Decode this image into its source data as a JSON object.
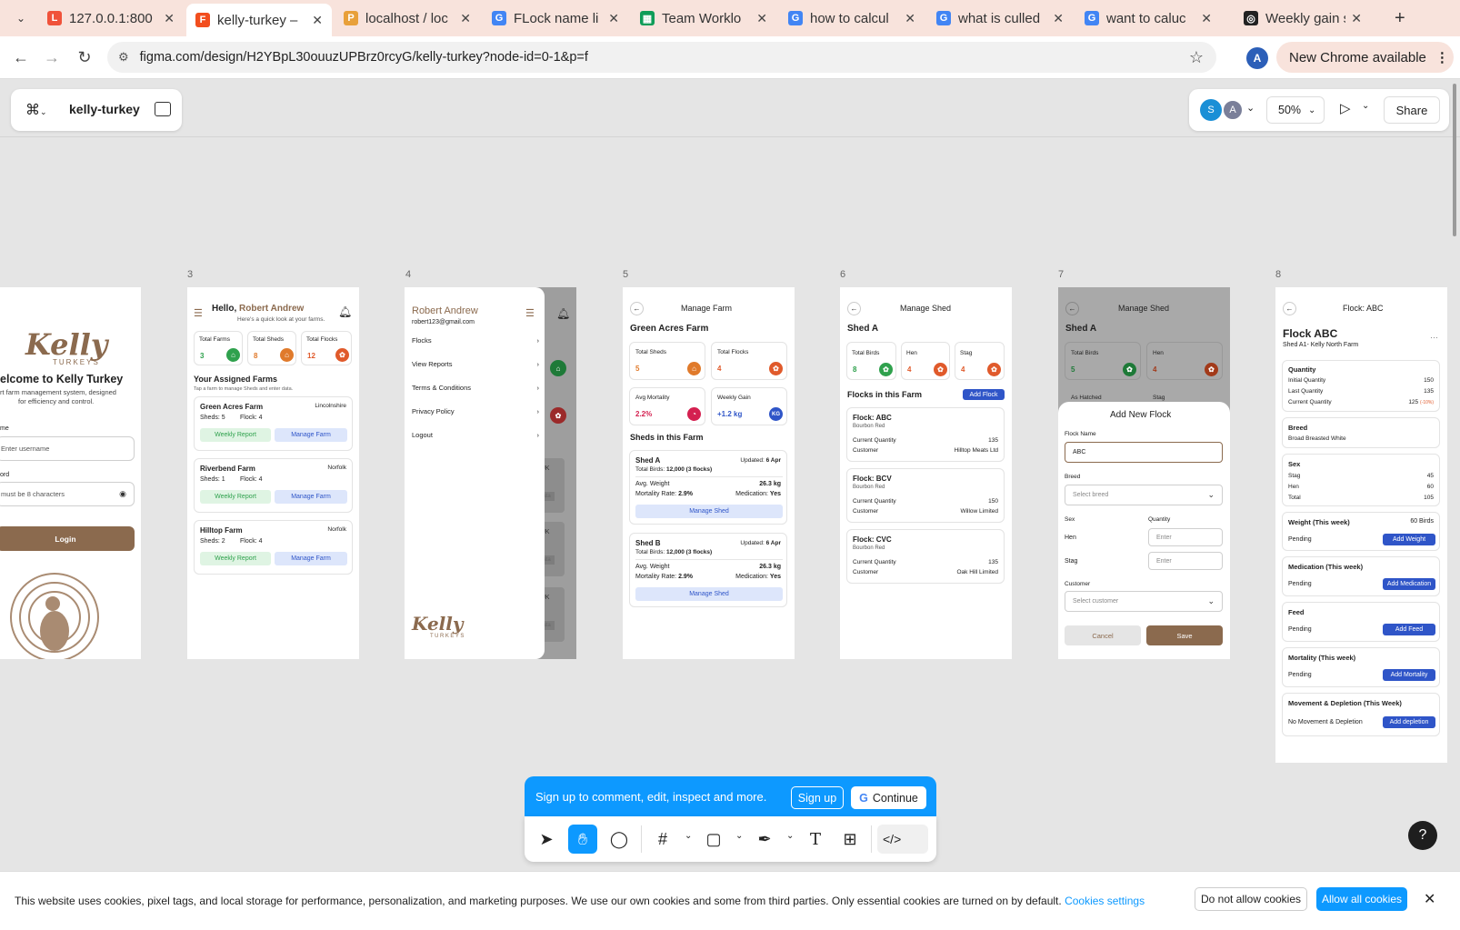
{
  "browser": {
    "tabs": [
      {
        "title": "127.0.0.1:800",
        "icon": "laravel-icon",
        "color": "#f0523a"
      },
      {
        "title": "kelly-turkey –",
        "icon": "figma-icon",
        "color": "#f24e1e",
        "active": true
      },
      {
        "title": "localhost / loc",
        "icon": "phpmyadmin-icon",
        "color": "#e8a03a"
      },
      {
        "title": "FLock name li",
        "icon": "google-icon",
        "color": "#4285f4"
      },
      {
        "title": "Team Worklo",
        "icon": "sheets-icon",
        "color": "#0f9d58"
      },
      {
        "title": "how to calcul",
        "icon": "google-icon",
        "color": "#4285f4"
      },
      {
        "title": "what is culled",
        "icon": "google-icon",
        "color": "#4285f4"
      },
      {
        "title": "want to caluc",
        "icon": "google-icon",
        "color": "#4285f4"
      },
      {
        "title": "Weekly gain s",
        "icon": "openai-icon",
        "color": "#222"
      }
    ],
    "url": "figma.com/design/H2YBpL30ouuzUPBrz0rcyG/kelly-turkey?node-id=0-1&p=f",
    "profile_initial": "A",
    "update_label": "New Chrome available"
  },
  "figma": {
    "file_name": "kelly-turkey",
    "avatars": [
      "S",
      "A"
    ],
    "zoom": "50%",
    "share_label": "Share"
  },
  "frames": {
    "labels": [
      "3",
      "4",
      "5",
      "6",
      "7",
      "8"
    ],
    "login": {
      "logo": "Kelly",
      "logo_sub": "TURKEYS",
      "welcome": "elcome to Kelly Turkey",
      "desc1": "rt farm management system, designed",
      "desc2": "for efficiency and control.",
      "user_label": "me",
      "user_ph": "Enter username",
      "pass_label": "ord",
      "pass_ph": "must be 8 characters",
      "login_btn": "Login"
    },
    "dashboard": {
      "hello": "Hello,",
      "name": "Robert Andrew",
      "sub": "Here's a quick look at your farms.",
      "stats": [
        {
          "label": "Total Farms",
          "value": "3"
        },
        {
          "label": "Total Sheds",
          "value": "8"
        },
        {
          "label": "Total Flocks",
          "value": "12"
        }
      ],
      "section": "Your Assigned Farms",
      "section_sub": "Tap a farm to manage Sheds and enter data.",
      "farms": [
        {
          "name": "Green Acres Farm",
          "loc": "Lincolnshire",
          "sheds": "Sheds: 5",
          "flock": "Flock: 4"
        },
        {
          "name": "Riverbend Farm",
          "loc": "Norfolk",
          "sheds": "Sheds: 1",
          "flock": "Flock: 4"
        },
        {
          "name": "Hilltop Farm",
          "loc": "Norfolk",
          "sheds": "Sheds: 2",
          "flock": "Flock: 4"
        }
      ],
      "weekly": "Weekly Report",
      "manage": "Manage Farm"
    },
    "menu": {
      "name": "Robert Andrew",
      "email": "robert123@gmail.com",
      "items": [
        "Flocks",
        "View Reports",
        "Terms & Conditions",
        "Privacy Policy",
        "Logout"
      ],
      "logo": "Kelly",
      "logo_sub": "TURKEYS",
      "bg": [
        "rk, UK",
        "Data",
        "rk, UK",
        "Data",
        "rk, UK",
        "Data"
      ]
    },
    "manage_farm": {
      "title": "Manage Farm",
      "farm": "Green Acres Farm",
      "stats": [
        {
          "label": "Total Sheds",
          "value": "5"
        },
        {
          "label": "Total Flocks",
          "value": "4"
        },
        {
          "label": "Avg Mortality",
          "value": "2.2%"
        },
        {
          "label": "Weekly Gain",
          "value": "+1.2 kg",
          "badge": "KG"
        }
      ],
      "section": "Sheds in this Farm",
      "sheds": [
        {
          "name": "Shed A",
          "updated": "Updated:",
          "date": "6 Apr",
          "birds_l": "Total Birds:",
          "birds": "12,000 (3 flocks)",
          "weight_l": "Avg. Weight",
          "weight": "26.3 kg",
          "mort_l": "Mortality Rate:",
          "mort": "2.9%",
          "med_l": "Medication:",
          "med": "Yes",
          "btn": "Manage Shed"
        },
        {
          "name": "Shed B",
          "updated": "Updated:",
          "date": "6 Apr",
          "birds_l": "Total Birds:",
          "birds": "12,000 (3 flocks)",
          "weight_l": "Avg. Weight",
          "weight": "26.3 kg",
          "mort_l": "Mortality Rate:",
          "mort": "2.9%",
          "med_l": "Medication:",
          "med": "Yes",
          "btn": "Manage Shed"
        }
      ]
    },
    "manage_shed": {
      "title": "Manage Shed",
      "shed": "Shed A",
      "stats": [
        {
          "label": "Total Birds",
          "value": "8"
        },
        {
          "label": "Hen",
          "value": "4"
        },
        {
          "label": "Stag",
          "value": "4"
        }
      ],
      "section": "Flocks in this Farm",
      "add": "Add Flock",
      "flocks": [
        {
          "name": "Flock: ABC",
          "breed": "Bourbon Red",
          "qty_l": "Current Quantity",
          "qty": "135",
          "cust_l": "Customer",
          "cust": "Hilltop Meats Ltd"
        },
        {
          "name": "Flock: BCV",
          "breed": "Bourbon Red",
          "qty_l": "Current Quantity",
          "qty": "150",
          "cust_l": "Customer",
          "cust": "Willow Limited"
        },
        {
          "name": "Flock: CVC",
          "breed": "Bourbon Red",
          "qty_l": "Current Quantity",
          "qty": "135",
          "cust_l": "Customer",
          "cust": "Oak Hill Limited"
        }
      ]
    },
    "add_flock": {
      "title": "Manage Shed",
      "shed": "Shed A",
      "bg_stats": [
        {
          "label": "Total Birds",
          "value": "5"
        },
        {
          "label": "Hen",
          "value": "4"
        }
      ],
      "bg2": [
        "As Hatched",
        "Stag"
      ],
      "modal": "Add New Flock",
      "name_l": "Flock Name",
      "name_v": "ABC",
      "breed_l": "Breed",
      "breed_ph": "Select breed",
      "sex_l": "Sex",
      "qty_l": "Quantity",
      "hen": "Hen",
      "stag": "Stag",
      "enter": "Enter",
      "cust_l": "Customer",
      "cust_ph": "Select customer",
      "cancel": "Cancel",
      "save": "Save"
    },
    "flock": {
      "title": "Flock: ABC",
      "heading": "Flock ABC",
      "sub": "Shed A1- Kelly North Farm",
      "dots": "···",
      "quantity": {
        "title": "Quantity",
        "rows": [
          {
            "l": "Initial Quantity",
            "v": "150"
          },
          {
            "l": "Last Quantity",
            "v": "135"
          },
          {
            "l": "Current Quantity",
            "v": "125",
            "note": "(-10%)"
          }
        ]
      },
      "breed": {
        "title": "Breed",
        "v": "Broad Breasted White"
      },
      "sex": {
        "title": "Sex",
        "rows": [
          {
            "l": "Stag",
            "v": "45"
          },
          {
            "l": "Hen",
            "v": "60"
          },
          {
            "l": "Total",
            "v": "105"
          }
        ]
      },
      "weight": {
        "title": "Weight (This week)",
        "v": "60 Birds",
        "status": "Pending",
        "btn": "Add Weight"
      },
      "med": {
        "title": "Medication (This week)",
        "status": "Pending",
        "btn": "Add Medication"
      },
      "feed": {
        "title": "Feed",
        "status": "Pending",
        "btn": "Add Feed"
      },
      "mort": {
        "title": "Mortality (This week)",
        "status": "Pending",
        "btn": "Add Mortality"
      },
      "move": {
        "title": "Movement & Depletion (This Week)",
        "status": "No Movement & Depletion",
        "btn": "Add depletion"
      }
    }
  },
  "signup": {
    "text": "Sign up to comment, edit, inspect and more.",
    "signup": "Sign up",
    "continue": "Continue"
  },
  "cookies": {
    "text": "This website uses cookies, pixel tags, and local storage for performance, personalization, and marketing purposes. We use our own cookies and some from third parties. Only essential cookies are turned on by default.",
    "settings": "Cookies settings",
    "deny": "Do not allow cookies",
    "allow": "Allow all cookies"
  },
  "colors": {
    "brown": "#8b6a4e",
    "blue": "#2f55c8",
    "green": "#2fa14d",
    "orange": "#e05a2b"
  }
}
